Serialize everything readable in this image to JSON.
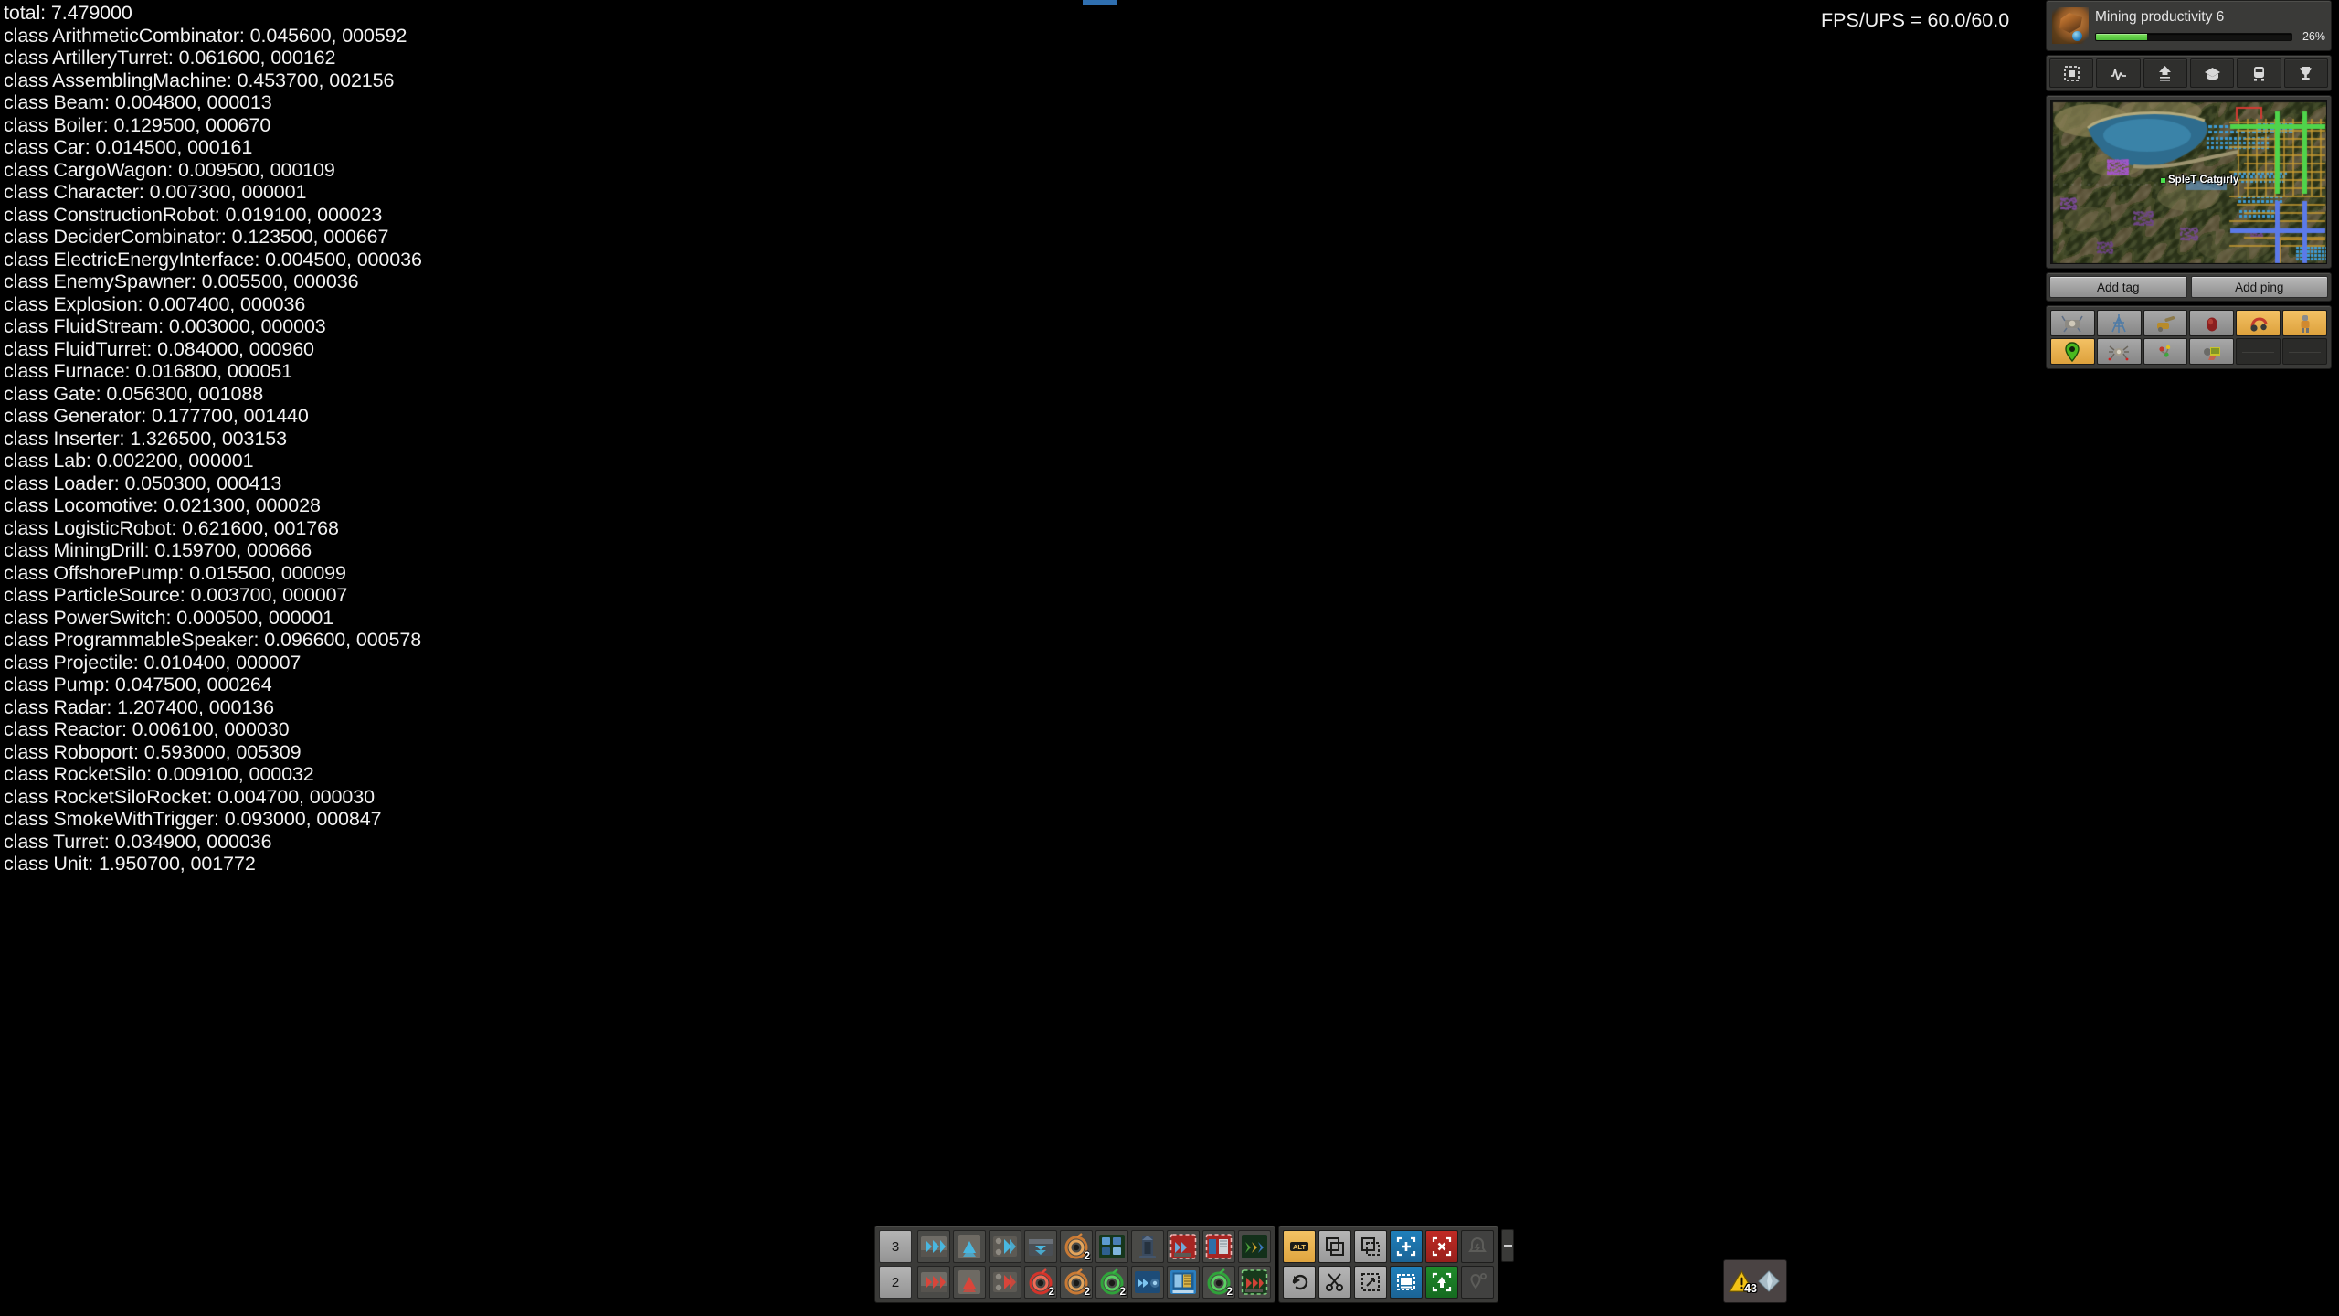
{
  "debug": {
    "total_label": "total: 7.479000",
    "lines": [
      "class ArithmeticCombinator: 0.045600, 000592",
      "class ArtilleryTurret: 0.061600, 000162",
      "class AssemblingMachine: 0.453700, 002156",
      "class Beam: 0.004800, 000013",
      "class Boiler: 0.129500, 000670",
      "class Car: 0.014500, 000161",
      "class CargoWagon: 0.009500, 000109",
      "class Character: 0.007300, 000001",
      "class ConstructionRobot: 0.019100, 000023",
      "class DeciderCombinator: 0.123500, 000667",
      "class ElectricEnergyInterface: 0.004500, 000036",
      "class EnemySpawner: 0.005500, 000036",
      "class Explosion: 0.007400, 000036",
      "class FluidStream: 0.003000, 000003",
      "class FluidTurret: 0.084000, 000960",
      "class Furnace: 0.016800, 000051",
      "class Gate: 0.056300, 001088",
      "class Generator: 0.177700, 001440",
      "class Inserter: 1.326500, 003153",
      "class Lab: 0.002200, 000001",
      "class Loader: 0.050300, 000413",
      "class Locomotive: 0.021300, 000028",
      "class LogisticRobot: 0.621600, 001768",
      "class MiningDrill: 0.159700, 000666",
      "class OffshorePump: 0.015500, 000099",
      "class ParticleSource: 0.003700, 000007",
      "class PowerSwitch: 0.000500, 000001",
      "class ProgrammableSpeaker: 0.096600, 000578",
      "class Projectile: 0.010400, 000007",
      "class Pump: 0.047500, 000264",
      "class Radar: 1.207400, 000136",
      "class Reactor: 0.006100, 000030",
      "class Roboport: 0.593000, 005309",
      "class RocketSilo: 0.009100, 000032",
      "class RocketSiloRocket: 0.004700, 000030",
      "class SmokeWithTrigger: 0.093000, 000847",
      "class Turret: 0.034900, 000036",
      "class Unit: 1.950700, 001772"
    ]
  },
  "fps": {
    "readout": "FPS/UPS = 60.0/60.0"
  },
  "research": {
    "name": "Mining productivity 6",
    "percent_label": "26%",
    "percent_value": 26,
    "bar_color": "#4fbf3a"
  },
  "hud_buttons": [
    {
      "name": "blueprint-library-icon",
      "label": "Blueprint library"
    },
    {
      "name": "production-statistics-icon",
      "label": "Production statistics"
    },
    {
      "name": "upgrade-planner-icon",
      "label": "Upgrade"
    },
    {
      "name": "technology-icon",
      "label": "Technology"
    },
    {
      "name": "train-overview-icon",
      "label": "Trains"
    },
    {
      "name": "achievements-icon",
      "label": "Achievements"
    }
  ],
  "minimap": {
    "player_label": "SpleT Catgirly",
    "player_dot_color": "#49e04b"
  },
  "map_actions": {
    "add_tag": "Add tag",
    "add_ping": "Add ping"
  },
  "shortcuts": [
    {
      "name": "shortcut-spidertron-remote",
      "state": "grey"
    },
    {
      "name": "shortcut-power-pole",
      "state": "grey"
    },
    {
      "name": "shortcut-artillery-remote",
      "state": "grey"
    },
    {
      "name": "shortcut-discharge-defense-remote",
      "state": "grey"
    },
    {
      "name": "shortcut-personal-roboport",
      "state": "amber"
    },
    {
      "name": "shortcut-exoskeleton",
      "state": "amber"
    },
    {
      "name": "shortcut-map-tag",
      "state": "amber"
    },
    {
      "name": "shortcut-spidertron",
      "state": "grey"
    },
    {
      "name": "shortcut-construction-robots",
      "state": "grey"
    },
    {
      "name": "shortcut-circuit-network",
      "state": "grey"
    },
    {
      "name": "shortcut-empty-1",
      "state": "empty"
    },
    {
      "name": "shortcut-empty-2",
      "state": "empty"
    }
  ],
  "quickbar": {
    "rows": [
      {
        "number": "3",
        "slots": [
          {
            "name": "express-transport-belt",
            "kind": "belt-blue",
            "count": ""
          },
          {
            "name": "express-underground-belt",
            "kind": "underground-blue",
            "count": ""
          },
          {
            "name": "express-splitter",
            "kind": "splitter-blue",
            "count": ""
          },
          {
            "name": "steel-chest",
            "kind": "chest-blue",
            "count": ""
          },
          {
            "name": "copper-cable",
            "kind": "coil-copper",
            "count": "2"
          },
          {
            "name": "blueprint-book-dark",
            "kind": "bpbook-green",
            "count": ""
          },
          {
            "name": "rail-signal-dark",
            "kind": "rail-dark",
            "count": ""
          },
          {
            "name": "deconstruction-belt",
            "kind": "decon-red",
            "count": ""
          },
          {
            "name": "deconstruction-module",
            "kind": "decon-red2",
            "count": ""
          },
          {
            "name": "blueprint-arrows",
            "kind": "arrows-green",
            "count": ""
          }
        ]
      },
      {
        "number": "2",
        "slots": [
          {
            "name": "fast-transport-belt",
            "kind": "belt-red",
            "count": ""
          },
          {
            "name": "fast-underground-belt",
            "kind": "underground-red",
            "count": ""
          },
          {
            "name": "fast-splitter",
            "kind": "splitter-red",
            "count": ""
          },
          {
            "name": "red-wire",
            "kind": "coil-red",
            "count": "2"
          },
          {
            "name": "copper-cable-2",
            "kind": "coil-copper",
            "count": "2"
          },
          {
            "name": "green-wire",
            "kind": "coil-green",
            "count": "2"
          },
          {
            "name": "blueprint-belt-blue",
            "kind": "bp-blue",
            "count": ""
          },
          {
            "name": "blueprint-book-blue",
            "kind": "bpbook-blue",
            "count": ""
          },
          {
            "name": "green-wire-2",
            "kind": "coil-green",
            "count": "2"
          },
          {
            "name": "blueprint-belt-green",
            "kind": "bp-green-belt",
            "count": ""
          }
        ]
      }
    ]
  },
  "tools": {
    "rows": [
      [
        {
          "name": "alt-mode-button",
          "glyph": "alt",
          "color": "amber"
        },
        {
          "name": "copy-button",
          "glyph": "copy",
          "color": "grey"
        },
        {
          "name": "copy-selection-button",
          "glyph": "copy-dashed",
          "color": "grey"
        },
        {
          "name": "new-blueprint-button",
          "glyph": "plus-select",
          "color": "blue"
        },
        {
          "name": "deconstruction-planner-button",
          "glyph": "x-select",
          "color": "red"
        },
        {
          "name": "discharge-defense-button",
          "glyph": "bell-disabled",
          "color": "dark"
        }
      ],
      [
        {
          "name": "undo-button",
          "glyph": "undo",
          "color": "grey"
        },
        {
          "name": "cut-button",
          "glyph": "scissors",
          "color": "grey"
        },
        {
          "name": "paste-button",
          "glyph": "paste-dashed",
          "color": "grey"
        },
        {
          "name": "blueprint-book-button",
          "glyph": "book-select",
          "color": "blue"
        },
        {
          "name": "upgrade-planner-button",
          "glyph": "up-select",
          "color": "green"
        },
        {
          "name": "map-tag-button",
          "glyph": "tag-disabled",
          "color": "dark"
        }
      ]
    ]
  },
  "alerts": {
    "count": "43",
    "warning_color": "#f2c216"
  }
}
